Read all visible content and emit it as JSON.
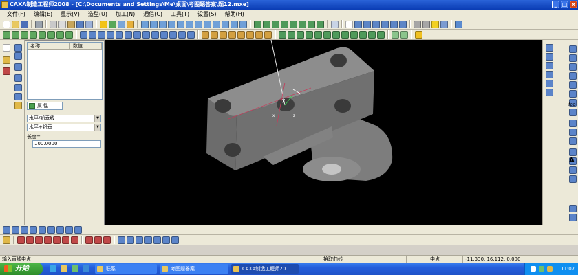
{
  "window": {
    "title": "CAXA制造工程师2008  - [C:\\Documents and Settings\\Me\\桌面\\考图题答案\\题12.mxe]",
    "controls": [
      "_",
      "□",
      "x"
    ]
  },
  "menu": {
    "items": [
      "文件(F)",
      "编辑(E)",
      "显示(V)",
      "造型(U)",
      "加工(N)",
      "通信(C)",
      "工具(T)",
      "设置(S)",
      "帮助(H)"
    ]
  },
  "properties_panel": {
    "col_name": "名称",
    "col_value": "数值",
    "tab_label": "属 性",
    "line_mode": "水平/铅垂线",
    "line_type": "水平+铅垂",
    "length_label": "长度=",
    "length_value": "100.0000"
  },
  "right_tools": {
    "font_glyph": "fco",
    "text_glyph": "A"
  },
  "canvas": {
    "axis_labels": [
      "y",
      "x",
      "z"
    ]
  },
  "status": {
    "prompt": "输入直线中点",
    "mode": "拾取曲线",
    "snap": "中点",
    "coords": "-11.330, 16.112, 0.000"
  },
  "taskbar": {
    "start": "开始",
    "tasks": [
      "联系",
      "考图题答案",
      "CAXA制造工程师20..."
    ],
    "clock": "11:07"
  },
  "colors": {
    "titlebar": "#0a3cb4",
    "canvas_bg": "#000000",
    "model_gray": "#8a8a8a",
    "taskbar": "#245edb",
    "start_green": "#2d8c2a"
  }
}
